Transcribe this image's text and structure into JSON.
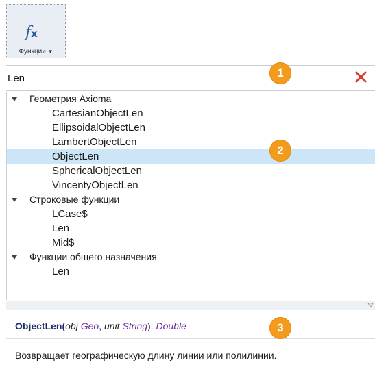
{
  "ribbon": {
    "functions_button_label": "Функции",
    "functions_icon": "fx-icon"
  },
  "search": {
    "value": "Len",
    "clear_icon": "close-icon",
    "clear_color": "#d93a2b"
  },
  "tree": {
    "selected_color": "#cce6f8",
    "groups": [
      {
        "label": "Геометрия Axioma",
        "items": [
          "CartesianObjectLen",
          "EllipsoidalObjectLen",
          "LambertObjectLen",
          "ObjectLen",
          "SphericalObjectLen",
          "VincentyObjectLen"
        ]
      },
      {
        "label": "Строковые функции",
        "items": [
          "LCase$",
          "Len",
          "Mid$"
        ]
      },
      {
        "label": "Функции общего назначения",
        "items": [
          "Len"
        ]
      }
    ],
    "selected_item": "ObjectLen"
  },
  "signature": {
    "function_name": "ObjectLen",
    "open_paren": "(",
    "param1_name": "obj",
    "param1_type": "Geo",
    "separator": ", ",
    "param2_name": "unit",
    "param2_type": "String",
    "close_paren_colon": "): ",
    "return_type": "Double"
  },
  "description": "Возвращает географическую длину линии или полилинии.",
  "callouts": [
    "1",
    "2",
    "3"
  ],
  "colors": {
    "badge": "#f29b1d",
    "function_name": "#1f2d6b",
    "type": "#6a2d9a"
  }
}
